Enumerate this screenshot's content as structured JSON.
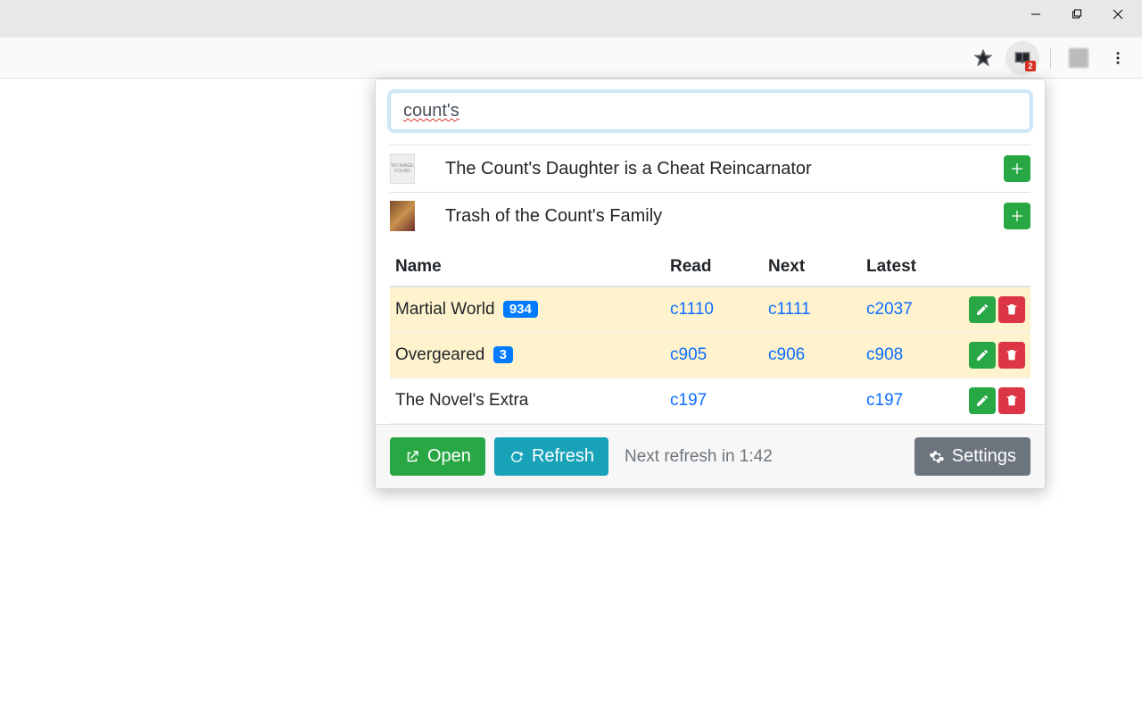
{
  "window": {
    "ext_badge": "2"
  },
  "search": {
    "value": "count's"
  },
  "results": [
    {
      "title": "The Count's Daughter is a Cheat Reincarnator",
      "thumb": "none"
    },
    {
      "title": "Trash of the Count's Family",
      "thumb": "cover"
    }
  ],
  "table": {
    "headers": {
      "name": "Name",
      "read": "Read",
      "next": "Next",
      "latest": "Latest"
    },
    "rows": [
      {
        "name": "Martial World",
        "badge": "934",
        "read": "c1110",
        "next": "c1111",
        "latest": "c2037",
        "highlight": true
      },
      {
        "name": "Overgeared",
        "badge": "3",
        "read": "c905",
        "next": "c906",
        "latest": "c908",
        "highlight": true
      },
      {
        "name": "The Novel's Extra",
        "badge": "",
        "read": "c197",
        "next": "",
        "latest": "c197",
        "highlight": false
      }
    ]
  },
  "footer": {
    "open": "Open",
    "refresh": "Refresh",
    "next_refresh": "Next refresh in 1:42",
    "settings": "Settings"
  }
}
